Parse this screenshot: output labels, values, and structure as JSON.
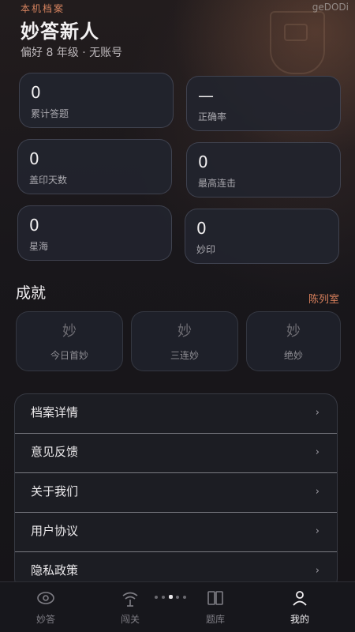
{
  "watermark": "geDODi",
  "header": {
    "kicker": "本机档案",
    "title": "妙答新人",
    "subtitle": "偏好 8 年级 · 无账号"
  },
  "stats": [
    {
      "value": "0",
      "label": "累计答题"
    },
    {
      "value": "—",
      "label": "正确率"
    },
    {
      "value": "0",
      "label": "盖印天数"
    },
    {
      "value": "0",
      "label": "最高连击"
    },
    {
      "value": "0",
      "label": "星海"
    },
    {
      "value": "0",
      "label": "妙印"
    }
  ],
  "achievements": {
    "title": "成就",
    "link": "陈列室",
    "items": [
      {
        "glyph": "妙",
        "name": "今日首妙"
      },
      {
        "glyph": "妙",
        "name": "三连妙"
      },
      {
        "glyph": "妙",
        "name": "绝妙"
      }
    ]
  },
  "menu": [
    {
      "label": "档案详情",
      "chevron": "›"
    },
    {
      "label": "意见反馈",
      "chevron": "›"
    },
    {
      "label": "关于我们",
      "chevron": "›"
    },
    {
      "label": "用户协议",
      "chevron": "›"
    },
    {
      "label": "隐私政策",
      "chevron": "›"
    }
  ],
  "tabbar": {
    "active": "我的",
    "tabs": [
      {
        "label": "妙答",
        "icon": "eye-icon"
      },
      {
        "label": "闯关",
        "icon": "signal-icon"
      },
      {
        "label": "题库",
        "icon": "book-icon"
      },
      {
        "label": "我的",
        "icon": "user-icon"
      }
    ],
    "page_dots": 5,
    "active_dot": 2
  },
  "colors": {
    "accent": "#d9805c",
    "card": "#22242e",
    "background": "#161519"
  }
}
